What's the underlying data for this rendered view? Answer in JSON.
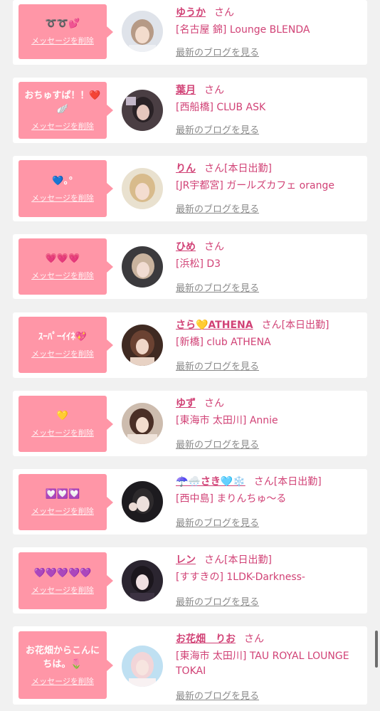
{
  "delete_label": "メッセージを削除",
  "blog_label": "最新のブログを見る",
  "honorific": "さん",
  "cards": [
    {
      "message": "➰➰💕",
      "name": "ゆうか",
      "status": "",
      "shop": "[名古屋 錦] Lounge BLENDA"
    },
    {
      "message": "おちゅすぱ！！❤️🪽",
      "name": "葉月",
      "status": "",
      "shop": "[西船橋] CLUB ASK"
    },
    {
      "message": "💙｡°",
      "name": "りん",
      "status": "[本日出勤]",
      "shop": "[JR宇都宮] ガールズカフェ orange"
    },
    {
      "message": "💗💗💗",
      "name": "ひめ",
      "status": "",
      "shop": "[浜松] D3"
    },
    {
      "message": "ｽｰﾊﾟｰｲｲﾈ💖",
      "name": "さら💛ATHENA",
      "status": "[本日出勤]",
      "shop": "[新橋] club ATHENA"
    },
    {
      "message": "💛",
      "name": "ゆず",
      "status": "",
      "shop": "[東海市 太田川] Annie"
    },
    {
      "message": "💟💟💟",
      "name": "☂️🌨️さき🩵❄️",
      "status": "[本日出勤]",
      "shop": "[西中島] まりんちゅ〜る"
    },
    {
      "message": "💜💜💜💜💜",
      "name": "レン",
      "status": "[本日出勤]",
      "shop": "[すすきの] 1LDK-Darkness-"
    },
    {
      "message": "お花畑からこんにちは。🌷",
      "name": "お花畑　りお",
      "status": "",
      "shop": "[東海市 太田川] TAU ROYAL LOUNGE TOKAI"
    }
  ],
  "colors": {
    "bubble": "#ff96a7",
    "accent": "#d14276",
    "link_gray": "#8a8a8a",
    "background": "#f1f1f1"
  }
}
